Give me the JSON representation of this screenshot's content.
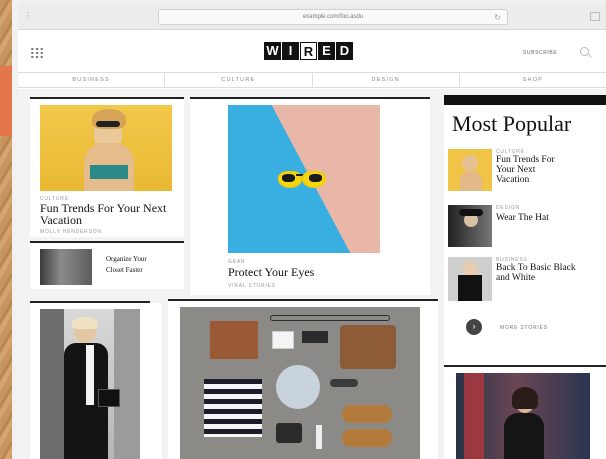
{
  "browser": {
    "url": "example.com/foo.asdu"
  },
  "site": {
    "logo_letters": [
      "W",
      "I",
      "R",
      "E",
      "D"
    ],
    "subscribe_label": "SUBSCRIBE",
    "nav": [
      "BUSINESS",
      "CULTURE",
      "DESIGN",
      "SHOP"
    ]
  },
  "stories": {
    "fun_trends": {
      "kicker": "CULTURE",
      "title": "Fun Trends For Your Next Vacation",
      "byline": "MOLLY HENDERSON"
    },
    "organize": {
      "title_line1": "Organize Your",
      "title_line2": "Closet Faster"
    },
    "protect": {
      "kicker": "GEAR",
      "title": "Protect Your Eyes",
      "byline": "VIRAL STORIES"
    }
  },
  "most_popular": {
    "heading": "Most Popular",
    "items": [
      {
        "kicker": "CULTURE",
        "title": "Fun Trends For Your Next Vacation"
      },
      {
        "kicker": "DESIGN",
        "title": "Wear The Hat"
      },
      {
        "kicker": "BUSINESS",
        "title": "Back To Basic Black and White"
      }
    ],
    "more_label": "MORE STORIES"
  },
  "icons": {
    "grid": "app-grid-icon",
    "search": "search-icon",
    "more": "arrow-right-icon",
    "reload": "reload-icon"
  }
}
